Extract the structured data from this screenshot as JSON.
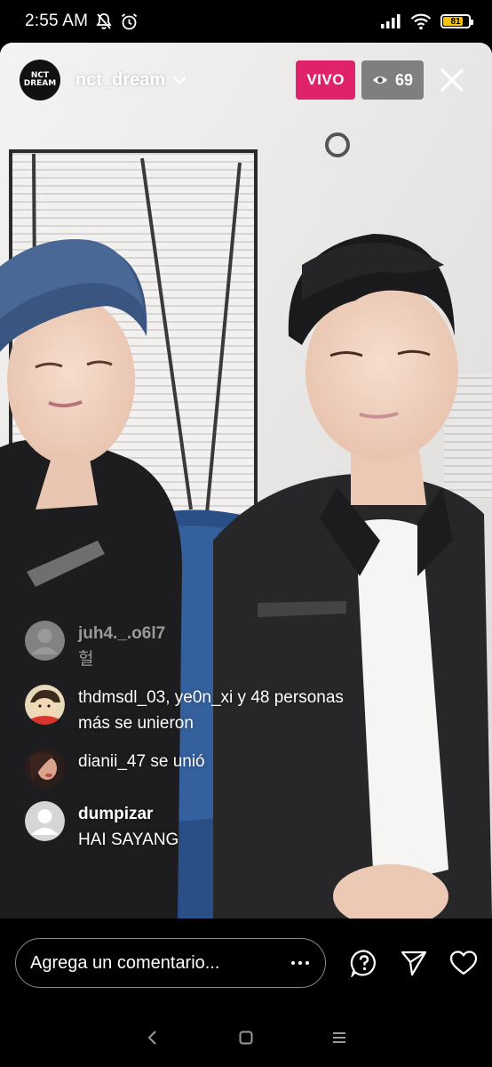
{
  "status_bar": {
    "time": "2:55 AM",
    "battery_level": "81",
    "battery_fraction": 0.81,
    "battery_color": "#f5c400"
  },
  "live": {
    "host": {
      "username": "nct_dream",
      "avatar_text": "NCT DREAM",
      "avatar_lines": [
        "NCT",
        "DREAM"
      ]
    },
    "live_badge": "VIVO",
    "live_badge_color": "#e0226b",
    "viewer_count": "69",
    "icons": {
      "viewer": "eye-icon",
      "close": "close-icon",
      "dropdown": "chevron-down-icon"
    }
  },
  "comments": [
    {
      "type": "comment",
      "username": "juh4._.o6l7",
      "text": "헐",
      "faded": true,
      "avatar": "default-avatar"
    },
    {
      "type": "join",
      "text_line1": "thdmsdl_03, ye0n_xi y 48 personas",
      "text_line2": "más se unieron",
      "avatar": "cartoon-avatar"
    },
    {
      "type": "join",
      "text": "dianii_47 se unió",
      "avatar": "photo-avatar"
    },
    {
      "type": "comment",
      "username": "dumpizar",
      "text": "HAI SAYANG",
      "faded": false,
      "avatar": "default-avatar"
    }
  ],
  "bottom_bar": {
    "comment_placeholder": "Agrega un comentario...",
    "more_icon": "more-horizontal-icon",
    "question_icon": "question-icon",
    "share_icon": "send-icon",
    "like_icon": "heart-icon"
  },
  "nav_bar": {
    "back_icon": "back-icon",
    "home_icon": "home-icon",
    "recents_icon": "menu-icon"
  }
}
